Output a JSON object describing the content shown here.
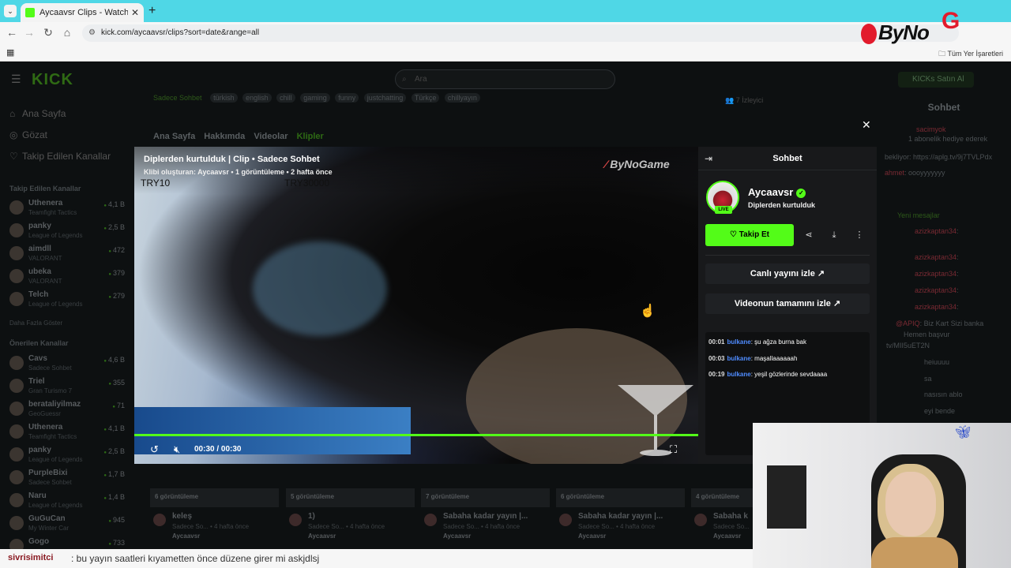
{
  "browser": {
    "tab_title": "Aycaavsr Clips - Watch Live on",
    "url": "kick.com/aycaavsr/clips?sort=date&range=all",
    "bookmarks_all": "Tüm Yer İşaretleri"
  },
  "overlay_logo": {
    "text": "ByNo",
    "letter": "G"
  },
  "kick": {
    "logo": "KICK",
    "search_placeholder": "Ara",
    "kicks_button": "KICKs Satın Al",
    "sidebar": {
      "main": [
        {
          "label": "Ana Sayfa",
          "icon": "home-icon"
        },
        {
          "label": "Gözat",
          "icon": "compass-icon"
        },
        {
          "label": "Takip Edilen Kanallar",
          "icon": "heart-icon"
        }
      ],
      "followed_header": "Takip Edilen Kanallar",
      "followed": [
        {
          "name": "Uthenera",
          "game": "Teamfight Tactics",
          "viewers": "4,1 B"
        },
        {
          "name": "panky",
          "game": "League of Legends",
          "viewers": "2,5 B"
        },
        {
          "name": "aimdll",
          "game": "VALORANT",
          "viewers": "472"
        },
        {
          "name": "ubeka",
          "game": "VALORANT",
          "viewers": "379"
        },
        {
          "name": "Telch",
          "game": "League of Legends",
          "viewers": "279"
        }
      ],
      "show_more": "Daha Fazla Göster",
      "recommended_header": "Önerilen Kanallar",
      "recommended": [
        {
          "name": "Cavs",
          "game": "Sadece Sohbet",
          "viewers": "4,6 B"
        },
        {
          "name": "Triel",
          "game": "Gran Turismo 7",
          "viewers": "355"
        },
        {
          "name": "berataliyilmaz",
          "game": "GeoGuessr",
          "viewers": "71"
        },
        {
          "name": "Uthenera",
          "game": "Teamfight Tactics",
          "viewers": "4,1 B"
        },
        {
          "name": "panky",
          "game": "League of Legends",
          "viewers": "2,5 B"
        },
        {
          "name": "PurpleBixi",
          "game": "Sadece Sohbet",
          "viewers": "1,7 B"
        },
        {
          "name": "Naru",
          "game": "League of Legends",
          "viewers": "1,4 B"
        },
        {
          "name": "GuGuCan",
          "game": "My Winter Car",
          "viewers": "945"
        },
        {
          "name": "Gogo",
          "game": "",
          "viewers": "733"
        }
      ]
    },
    "channel_bar": {
      "category": "Sadece Sohbet",
      "tags": [
        "türkish",
        "english",
        "chill",
        "gaming",
        "funny",
        "justchatting",
        "Türkçe",
        "chillyayın"
      ],
      "viewers": "7 İzleyici"
    },
    "page_tabs": [
      "Ana Sayfa",
      "Hakkımda",
      "Videolar",
      "Klipler"
    ],
    "bg_chat": {
      "header": "Sohbet",
      "lines": [
        {
          "user": "sacimyok",
          "text": ""
        },
        {
          "user": "",
          "text": "1 abonelik hediye ederek"
        },
        {
          "user": "",
          "text": "bekliyor: https://aplg.tv/9j7TVLPdx"
        },
        {
          "user": "ahmet",
          "text": "oooyyyyyyy"
        },
        {
          "user": "",
          "text": "Yeni mesajlar"
        },
        {
          "user": "azizkaptan34",
          "text": ""
        },
        {
          "user": "azizkaptan34",
          "text": ""
        },
        {
          "user": "azizkaptan34",
          "text": ""
        },
        {
          "user": "azizkaptan34",
          "text": ""
        },
        {
          "user": "azizkaptan34",
          "text": ""
        },
        {
          "user": "@APIQ",
          "text": "Biz Kart Sizi banka"
        },
        {
          "user": "",
          "text": "Hemen başvur"
        },
        {
          "user": "",
          "text": "tv/MII5uET2N"
        },
        {
          "user": "",
          "text": "heiuuuu"
        },
        {
          "user": "",
          "text": "sa"
        },
        {
          "user": "",
          "text": "nasısın ablo"
        },
        {
          "user": "",
          "text": "eyi bende"
        }
      ]
    },
    "clips": [
      {
        "views": "6 görüntüleme",
        "title": "keleş",
        "meta": "Sadece So... • 4 hafta önce",
        "author": "Aycaavsr"
      },
      {
        "views": "5 görüntüleme",
        "title": "1)",
        "meta": "Sadece So... • 4 hafta önce",
        "author": "Aycaavsr"
      },
      {
        "views": "7 görüntüleme",
        "title": "Sabaha kadar yayın |...",
        "meta": "Sadece So... • 4 hafta önce",
        "author": "Aycaavsr"
      },
      {
        "views": "6 görüntüleme",
        "title": "Sabaha kadar yayın |...",
        "meta": "Sadece So... • 4 hafta önce",
        "author": "Aycaavsr"
      },
      {
        "views": "4 görüntüleme",
        "title": "Sabaha k",
        "meta": "Sadece So...",
        "author": "Aycaavsr"
      }
    ]
  },
  "modal": {
    "video": {
      "title": "Diplerden kurtulduk | Clip • Sadece Sohbet",
      "meta": "Klibi oluşturan: Aycaavsr • 1 görüntüleme • 2 hafta önce",
      "overlay_left": "TRY10",
      "overlay_right": "TRY30000",
      "watermark": "ByNoGame",
      "time": "00:30 / 00:30",
      "progress": 1.0
    },
    "panel": {
      "header": "Sohbet",
      "channel_name": "Aycaavsr",
      "live_badge": "LIVE",
      "clip_title": "Diplerden kurtulduk",
      "follow_label": "Takip Et",
      "watch_live": "Canlı yayını izle",
      "watch_full": "Videonun tamamını izle",
      "messages": [
        {
          "time": "00:01",
          "user": "bulkane",
          "text": ": şu ağza burna bak"
        },
        {
          "time": "00:03",
          "user": "bulkane",
          "text": ": maşallaaaaaah"
        },
        {
          "time": "00:19",
          "user": "bulkane",
          "text": ": yeşil gözlerinde sevdaaaa"
        }
      ]
    }
  },
  "ticker": {
    "user": "sivrisimitci",
    "message": ": bu yayın saatleri kıyametten önce düzene girer mi askjdlsj"
  },
  "colors": {
    "kick_green": "#53fc18",
    "link_blue": "#4f8cff"
  }
}
